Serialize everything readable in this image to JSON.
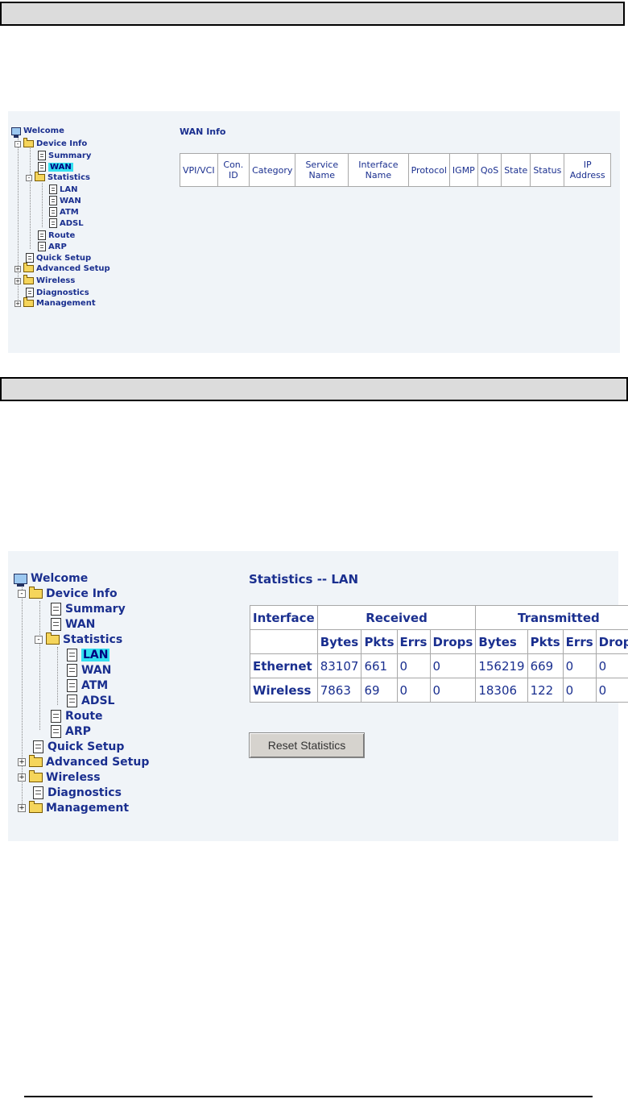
{
  "wan_screen": {
    "tree": {
      "welcome": "Welcome",
      "device_info": "Device Info",
      "summary": "Summary",
      "wan": "WAN",
      "statistics": "Statistics",
      "stat_lan": "LAN",
      "stat_wan": "WAN",
      "stat_atm": "ATM",
      "stat_adsl": "ADSL",
      "route": "Route",
      "arp": "ARP",
      "quick_setup": "Quick Setup",
      "advanced_setup": "Advanced Setup",
      "wireless": "Wireless",
      "diagnostics": "Diagnostics",
      "management": "Management",
      "expand": "+",
      "collapse": "-"
    },
    "title": "WAN Info",
    "columns": [
      "VPI/VCI",
      "Con. ID",
      "Category",
      "Service Name",
      "Interface Name",
      "Protocol",
      "IGMP",
      "QoS",
      "State",
      "Status",
      "IP Address"
    ]
  },
  "lan_screen": {
    "tree": {
      "welcome": "Welcome",
      "device_info": "Device Info",
      "summary": "Summary",
      "wan": "WAN",
      "statistics": "Statistics",
      "stat_lan": "LAN",
      "stat_wan": "WAN",
      "stat_atm": "ATM",
      "stat_adsl": "ADSL",
      "route": "Route",
      "arp": "ARP",
      "quick_setup": "Quick Setup",
      "advanced_setup": "Advanced Setup",
      "wireless": "Wireless",
      "diagnostics": "Diagnostics",
      "management": "Management",
      "expand": "+",
      "collapse": "-"
    },
    "title": "Statistics -- LAN",
    "header": {
      "interface": "Interface",
      "received": "Received",
      "transmitted": "Transmitted",
      "sub": [
        "Bytes",
        "Pkts",
        "Errs",
        "Drops",
        "Bytes",
        "Pkts",
        "Errs",
        "Drops"
      ]
    },
    "rows": [
      {
        "name": "Ethernet",
        "values": [
          "83107",
          "661",
          "0",
          "0",
          "156219",
          "669",
          "0",
          "0"
        ]
      },
      {
        "name": "Wireless",
        "values": [
          "7863",
          "69",
          "0",
          "0",
          "18306",
          "122",
          "0",
          "0"
        ]
      }
    ],
    "reset_button": "Reset Statistics"
  },
  "colors": {
    "panel_bg": "#f0f4f8",
    "link_blue": "#1a2f8f",
    "highlight": "#33e0f0"
  }
}
